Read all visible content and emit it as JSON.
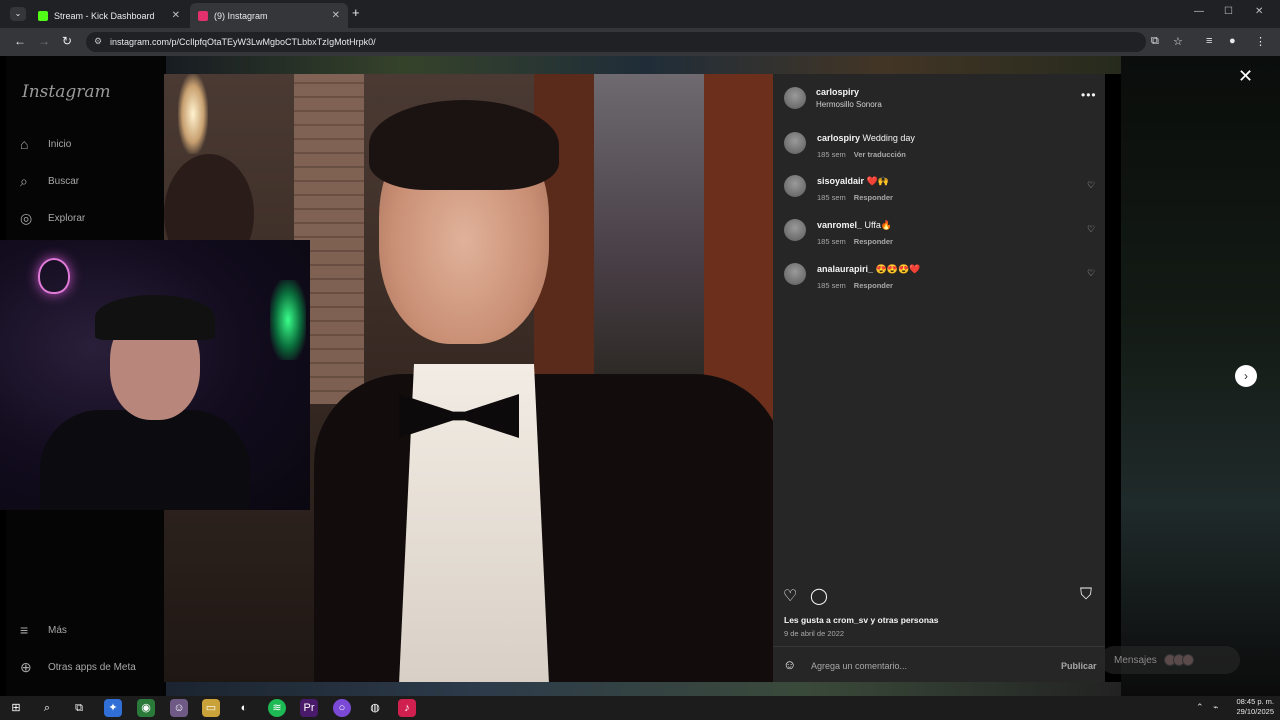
{
  "browser": {
    "tabs": [
      {
        "title": "Stream - Kick Dashboard",
        "favicon_color": "#53fc18",
        "active": false
      },
      {
        "title": "(9) Instagram",
        "favicon_color": "#e1306c",
        "active": true
      }
    ],
    "new_tab_icon": "+",
    "address": "instagram.com/p/CcIlpfqOtaTEyW3LwMgboCTLbbxTzIgMotHrpk0/",
    "window_controls": {
      "minimize": "—",
      "maximize": "☐",
      "close": "✕"
    }
  },
  "instagram": {
    "logo": "Instagram",
    "nav": [
      {
        "label": "Inicio",
        "icon": "home-icon",
        "glyph": "⌂"
      },
      {
        "label": "Buscar",
        "icon": "search-icon",
        "glyph": "⌕"
      },
      {
        "label": "Explorar",
        "icon": "compass-icon",
        "glyph": "◎"
      },
      {
        "label": "Más",
        "icon": "menu-icon",
        "glyph": "≡"
      },
      {
        "label": "Otras apps de Meta",
        "icon": "meta-apps-icon",
        "glyph": "⊕"
      }
    ],
    "messages_label": "Mensajes"
  },
  "post": {
    "author": "carlospiry",
    "location": "Hermosillo Sonora",
    "caption": {
      "user": "carlospiry",
      "text": "Wedding day",
      "age": "185 sem",
      "action": "Ver traducción"
    },
    "comments": [
      {
        "user": "sisoyaldair",
        "text": "❤️🙌",
        "age": "185 sem",
        "action": "Responder"
      },
      {
        "user": "vanromel_",
        "text": "Uffa🔥",
        "age": "185 sem",
        "action": "Responder"
      },
      {
        "user": "analaurapiri_",
        "text": "😍😍😍❤️",
        "age": "185 sem",
        "action": "Responder"
      }
    ],
    "likes_text": "Les gusta a crom_sv y otras personas",
    "date": "9 de abril de 2022",
    "comment_placeholder": "Agrega un comentario...",
    "publish_label": "Publicar"
  },
  "taskbar": {
    "time": "08:45 p. m.",
    "date": "29/10/2025"
  }
}
